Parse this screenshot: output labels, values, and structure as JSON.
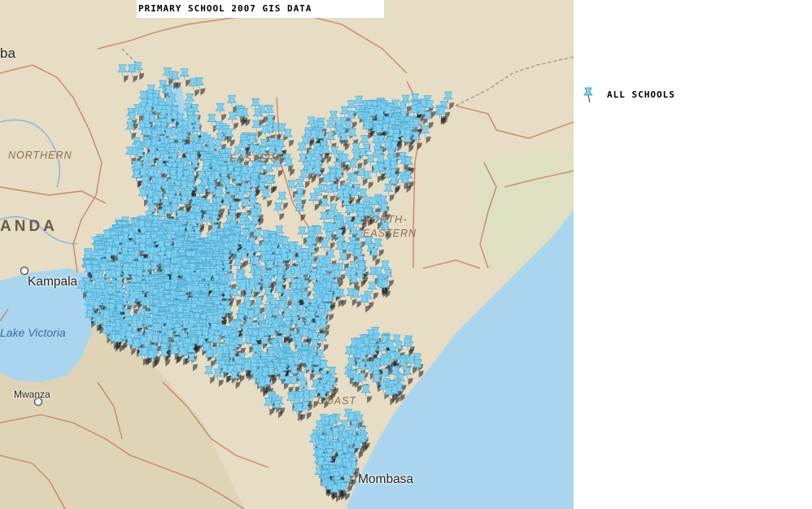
{
  "title": "PRIMARY SCHOOL 2007 GIS DATA",
  "legend": {
    "label": "ALL SCHOOLS",
    "icon": "pushpin-icon",
    "color": "#7fd0ef"
  },
  "map": {
    "labels": {
      "country_partial": "ANDA",
      "ethiopia_partial": "ba",
      "northern": "NORTHERN",
      "eastern": "EASTERN",
      "north_eastern": "NORTH-EASTERN",
      "coast": "COAST",
      "kampala": "Kampala",
      "lake_victoria": "Lake Victoria",
      "mwanza": "Mwanza",
      "mombasa": "Mombasa"
    },
    "colors": {
      "land": "#e7dcc4",
      "water": "#a9d6ee",
      "boundary": "#c9876a",
      "pin": "#7fd0ef",
      "pin_shadow": "#1a1a1a"
    }
  }
}
